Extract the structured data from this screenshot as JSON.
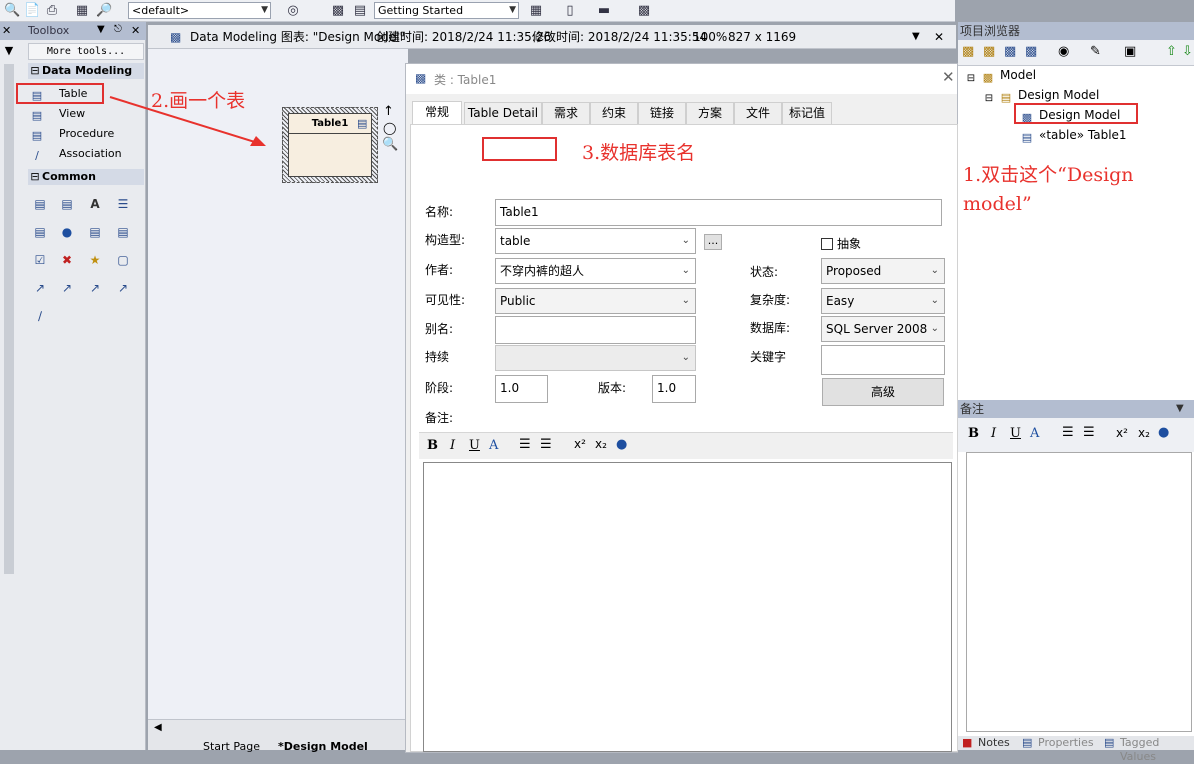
{
  "toolbar": {
    "perspective_value": "<default>",
    "workspace_value": "Getting Started"
  },
  "toolbox": {
    "title": "Toolbox",
    "more_tools": "More tools...",
    "sections": [
      {
        "label": "Data Modeling",
        "items": [
          {
            "label": "Table",
            "icon": "table-icon"
          },
          {
            "label": "View",
            "icon": "view-icon"
          },
          {
            "label": "Procedure",
            "icon": "procedure-icon"
          },
          {
            "label": "Association",
            "icon": "association-icon"
          }
        ]
      },
      {
        "label": "Common"
      }
    ]
  },
  "diagram": {
    "tab_title": "Data Modeling 图表: \"Design Model\"",
    "created_label": "创建时间: 2018/2/24 11:35:26",
    "modified_label": "修改时间: 2018/2/24 11:35:54",
    "zoom": "100%",
    "size": "827 x 1169",
    "element_name": "Table1",
    "bottom_tabs": [
      "Start Page",
      "*Design Model"
    ]
  },
  "dialog": {
    "title": "类 : Table1",
    "tabs": [
      "常规",
      "Table Detail",
      "需求",
      "约束",
      "链接",
      "方案",
      "文件",
      "标记值"
    ],
    "fields": {
      "name_label": "名称:",
      "name_value": "Table1",
      "stereotype_label": "构造型:",
      "stereotype_value": "table",
      "author_label": "作者:",
      "author_value": "不穿内裤的超人",
      "visibility_label": "可见性:",
      "visibility_value": "Public",
      "alias_label": "别名:",
      "persistence_label": "持续",
      "phase_label": "阶段:",
      "phase_value": "1.0",
      "version_label": "版本:",
      "version_value": "1.0",
      "abstract_label": "抽象",
      "status_label": "状态:",
      "status_value": "Proposed",
      "complexity_label": "复杂度:",
      "complexity_value": "Easy",
      "database_label": "数据库:",
      "database_value": "SQL Server 2008",
      "keywords_label": "关键字",
      "advanced_button": "高级",
      "notes_label": "备注:",
      "ellipsis_button": "..."
    }
  },
  "project_browser": {
    "title": "项目浏览器",
    "tree": [
      "Model",
      "Design Model",
      "Design Model",
      "«table» Table1"
    ],
    "notes_title": "备注",
    "bottom_tabs": [
      "Notes",
      "Properties",
      "Tagged Values"
    ]
  },
  "annotations": {
    "step1_line1": "1.双击这个“Design",
    "step1_line2": "model”",
    "step2": "2.画一个表",
    "step3": "3.数据库表名"
  },
  "colors": {
    "annotation_red": "#e8322d",
    "panel_header": "#b3bdd0",
    "canvas_bg": "#eef0f6",
    "element_fill": "#f7eee0"
  }
}
